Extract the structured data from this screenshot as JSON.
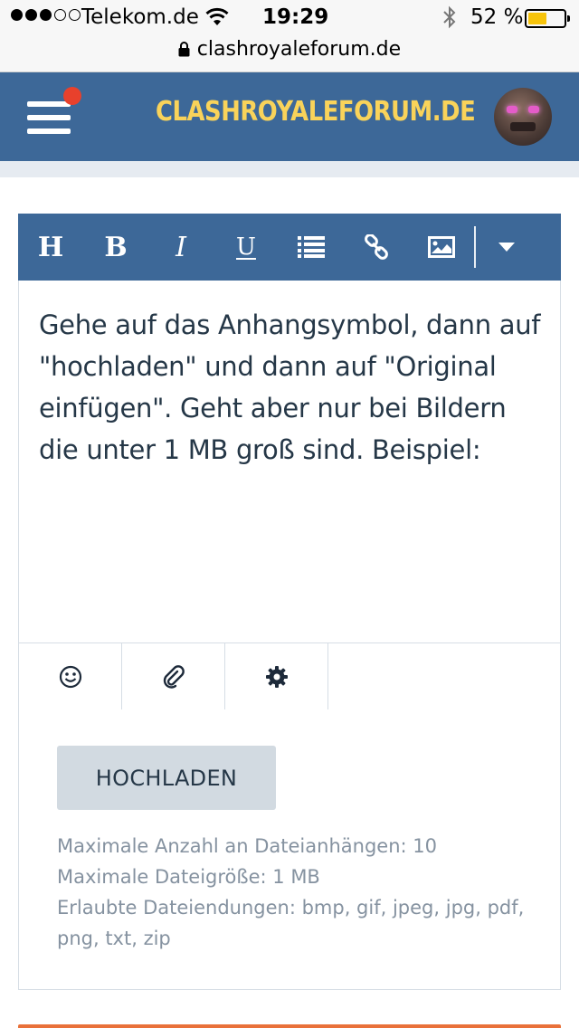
{
  "status_bar": {
    "carrier": "Telekom.de",
    "time": "19:29",
    "battery_percent": "52 %",
    "battery_level": 0.52
  },
  "url_bar": {
    "url": "clashroyaleforum.de"
  },
  "header": {
    "logo_text": "CLASHROYALEFORUM.DE",
    "menu_has_notification": true,
    "colors": {
      "bar": "#3d6898",
      "logo": "#f9d35a",
      "notification": "#e8412c"
    }
  },
  "editor": {
    "toolbar": {
      "heading_label": "H",
      "bold_label": "B",
      "italic_label": "I",
      "underline_label": "U",
      "icons": [
        "heading-icon",
        "bold-icon",
        "italic-icon",
        "underline-icon",
        "list-icon",
        "link-icon",
        "image-icon",
        "dropdown-caret-icon"
      ]
    },
    "text": "Gehe auf das Anhangsymbol, dann auf \"hochladen\" und dann auf \"Original einfügen\". Geht aber nur bei Bildern die unter 1 MB groß sind. Beispiel:",
    "tabs": [
      {
        "icon": "smiley-icon",
        "active": false
      },
      {
        "icon": "paperclip-icon",
        "active": true
      },
      {
        "icon": "gear-icon",
        "active": false
      }
    ]
  },
  "attachments": {
    "upload_button_label": "HOCHLADEN",
    "max_attachments": "Maximale Anzahl an Dateianhängen: 10",
    "max_filesize": "Maximale Dateigröße: 1 MB",
    "allowed_extensions": "Erlaubte Dateiendungen: bmp, gif, jpeg, jpg, pdf, png, txt, zip"
  }
}
